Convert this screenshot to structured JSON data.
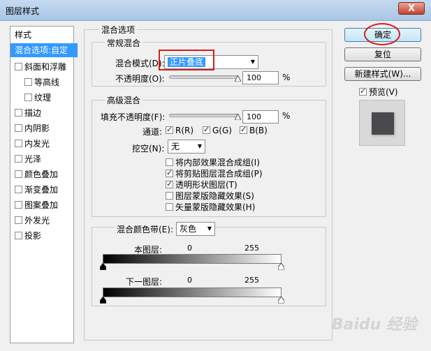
{
  "window": {
    "title": "图层样式",
    "close_label": "X"
  },
  "left_panel": {
    "items": [
      {
        "label": "样式",
        "checkbox": false,
        "checked": false,
        "selected": false,
        "indent": 0
      },
      {
        "label": "混合选项:自定",
        "checkbox": false,
        "checked": false,
        "selected": true,
        "indent": 0
      },
      {
        "label": "斜面和浮雕",
        "checkbox": true,
        "checked": false,
        "selected": false,
        "indent": 0
      },
      {
        "label": "等高线",
        "checkbox": true,
        "checked": false,
        "selected": false,
        "indent": 1
      },
      {
        "label": "纹理",
        "checkbox": true,
        "checked": false,
        "selected": false,
        "indent": 1
      },
      {
        "label": "描边",
        "checkbox": true,
        "checked": false,
        "selected": false,
        "indent": 0
      },
      {
        "label": "内阴影",
        "checkbox": true,
        "checked": false,
        "selected": false,
        "indent": 0
      },
      {
        "label": "内发光",
        "checkbox": true,
        "checked": false,
        "selected": false,
        "indent": 0
      },
      {
        "label": "光泽",
        "checkbox": true,
        "checked": false,
        "selected": false,
        "indent": 0
      },
      {
        "label": "颜色叠加",
        "checkbox": true,
        "checked": false,
        "selected": false,
        "indent": 0
      },
      {
        "label": "渐变叠加",
        "checkbox": true,
        "checked": false,
        "selected": false,
        "indent": 0
      },
      {
        "label": "图案叠加",
        "checkbox": true,
        "checked": false,
        "selected": false,
        "indent": 0
      },
      {
        "label": "外发光",
        "checkbox": true,
        "checked": false,
        "selected": false,
        "indent": 0
      },
      {
        "label": "投影",
        "checkbox": true,
        "checked": false,
        "selected": false,
        "indent": 0
      }
    ]
  },
  "blend_options": {
    "title": "混合选项",
    "general": {
      "title": "常规混合",
      "mode_label": "混合模式(D):",
      "mode_value": "正片叠底",
      "opacity_label": "不透明度(O):",
      "opacity_value": "100",
      "opacity_unit": "%"
    },
    "advanced": {
      "title": "高级混合",
      "fill_opacity_label": "填充不透明度(F):",
      "fill_opacity_value": "100",
      "fill_opacity_unit": "%",
      "channels_label": "通道:",
      "channel_r": "R(R)",
      "channel_g": "G(G)",
      "channel_b": "B(B)",
      "knockout_label": "挖空(N):",
      "knockout_value": "无",
      "options": [
        {
          "label": "将内部效果混合成组(I)",
          "checked": false
        },
        {
          "label": "将剪贴图层混合成组(P)",
          "checked": true
        },
        {
          "label": "透明形状图层(T)",
          "checked": true
        },
        {
          "label": "图层蒙版隐藏效果(S)",
          "checked": false
        },
        {
          "label": "矢量蒙版隐藏效果(H)",
          "checked": false
        }
      ]
    },
    "blend_if": {
      "label": "混合颜色带(E):",
      "value": "灰色",
      "this_layer_label": "本图层:",
      "this_layer_min": "0",
      "this_layer_max": "255",
      "underlying_label": "下一图层:",
      "underlying_min": "0",
      "underlying_max": "255"
    }
  },
  "buttons": {
    "ok": "确定",
    "reset": "复位",
    "new_style": "新建样式(W)...",
    "preview": "预览(V)"
  },
  "watermark": "Baidu 经验",
  "colors": {
    "selection": "#3399ff",
    "highlight": "#d81e1e",
    "preview_swatch": "#4a4a4e"
  }
}
